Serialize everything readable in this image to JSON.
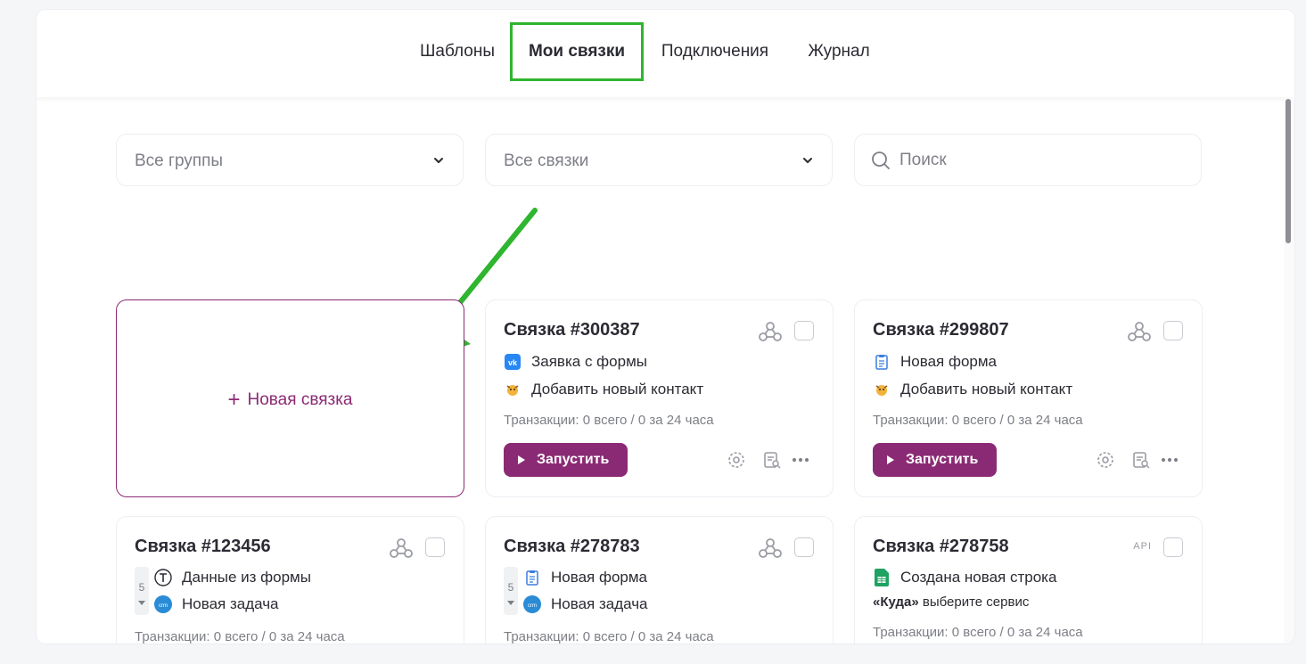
{
  "tabs": [
    {
      "label": "Шаблоны",
      "active": false
    },
    {
      "label": "Мои связки",
      "active": true
    },
    {
      "label": "Подключения",
      "active": false
    },
    {
      "label": "Журнал",
      "active": false
    }
  ],
  "filters": {
    "groups_label": "Все группы",
    "links_label": "Все связки",
    "search_placeholder": "Поиск"
  },
  "new_link_label": "Новая связка",
  "cards": [
    {
      "title": "Связка #300387",
      "badge": "webhook-icon",
      "trigger": {
        "icon": "vk-icon",
        "text": "Заявка с формы"
      },
      "action": {
        "icon": "contact-avatar-icon",
        "text": "Добавить новый контакт"
      },
      "transactions": "Транзакции: 0 всего / 0 за 24 часа",
      "run_label": "Запустить"
    },
    {
      "title": "Связка #299807",
      "badge": "webhook-icon",
      "trigger": {
        "icon": "clipboard-icon",
        "text": "Новая форма"
      },
      "action": {
        "icon": "contact-avatar-icon",
        "text": "Добавить новый контакт"
      },
      "transactions": "Транзакции: 0 всего / 0 за 24 часа",
      "run_label": "Запустить"
    },
    {
      "title": "Связка #123456",
      "badge": "webhook-icon",
      "step_count": "5",
      "trigger": {
        "icon": "text-t-icon",
        "text": "Данные из формы"
      },
      "action": {
        "icon": "crm-icon",
        "text": "Новая задача"
      },
      "transactions": "Транзакции: 0 всего / 0 за 24 часа"
    },
    {
      "title": "Связка #278783",
      "badge": "webhook-icon",
      "step_count": "5",
      "trigger": {
        "icon": "clipboard-icon",
        "text": "Новая форма"
      },
      "action": {
        "icon": "crm-icon",
        "text": "Новая задача"
      },
      "transactions": "Транзакции: 0 всего / 0 за 24 часа"
    },
    {
      "title": "Связка #278758",
      "badge_text": "API",
      "trigger": {
        "icon": "google-sheets-icon",
        "text": "Создана новая строка"
      },
      "target_bold": "«Куда»",
      "target_rest": " выберите сервис",
      "transactions": "Транзакции: 0 всего / 0 за 24 часа"
    }
  ],
  "colors": {
    "accent": "#8b2a74",
    "highlight": "#2fb52f",
    "muted": "#7d7f86"
  }
}
